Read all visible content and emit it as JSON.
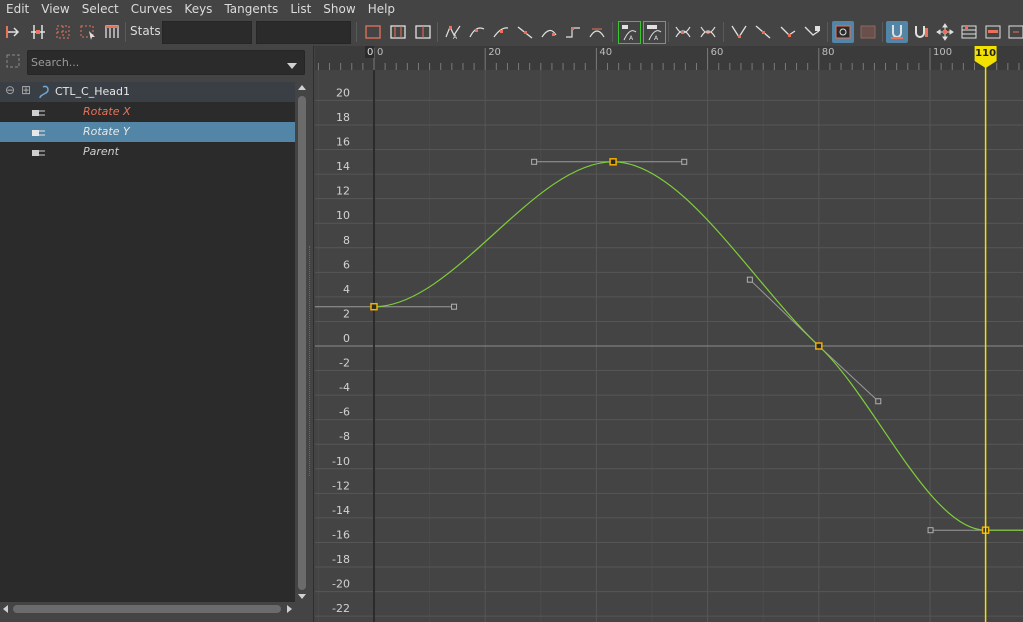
{
  "menubar": {
    "items": [
      "Edit",
      "View",
      "Select",
      "Curves",
      "Keys",
      "Tangents",
      "List",
      "Show",
      "Help"
    ]
  },
  "toolbar": {
    "stats_label": "Stats",
    "icons": [
      "move-nearest-picked-key-icon",
      "insert-keys-icon",
      "lattice-deform-keys-icon",
      "region-keys-icon",
      "retime-tool-icon",
      "normalize-curves-icon",
      "denormalize-curves-icon",
      "simplify-curves-icon",
      "auto-tangent-icon",
      "spline-tangent-icon",
      "clamped-tangent-icon",
      "linear-tangent-icon",
      "flat-tangent-icon",
      "step-tangent-icon",
      "plateau-tangent-icon",
      "default-in-tangent-icon",
      "default-out-tangent-icon",
      "buffer-curve-snapshot-icon",
      "swap-buffer-curve-icon",
      "break-tangents-icon",
      "unify-tangents-icon",
      "free-tangent-weight-icon",
      "lock-tangent-weight-icon",
      "auto-load-icon",
      "load-selected-icon",
      "time-snap-icon",
      "value-snap-icon",
      "frame-all-icon",
      "dope-sheet-icon",
      "trax-editor-icon",
      "scroll-right-icon"
    ],
    "accent": "#5285a6"
  },
  "outliner": {
    "search_placeholder": "Search...",
    "node": {
      "label": "CTL_C_Head1",
      "expand_symbol": "⊖",
      "add_symbol": "⊞"
    },
    "attributes": [
      {
        "label": "Rotate X",
        "color": "#e8735a",
        "selected": false
      },
      {
        "label": "Rotate Y",
        "color": "#e8e8e8",
        "selected": true
      },
      {
        "label": "Parent",
        "color": "#cfcfcf",
        "selected": false
      }
    ],
    "selected_color": "#5285a6"
  },
  "graph": {
    "current_frame": "110",
    "timeline_start_label": "0",
    "time_marker_color": "#f2e000",
    "curve_color": "#7fcf3a",
    "key_color": "#f2b000"
  },
  "chart_data": {
    "type": "line",
    "title": "",
    "xlabel": "",
    "ylabel": "",
    "xlim": [
      -10.6,
      116.7
    ],
    "ylim": [
      -23,
      23
    ],
    "x_ticks": [
      0,
      20,
      40,
      60,
      80,
      100
    ],
    "y_ticks": [
      20,
      18,
      16,
      14,
      12,
      10,
      8,
      6,
      4,
      2,
      0,
      -2,
      -4,
      -6,
      -8,
      -10,
      -12,
      -14,
      -16,
      -18,
      -20,
      -22
    ],
    "grid": true,
    "keys": [
      {
        "frame": 0,
        "value": 3.2,
        "in_tangent": [
          -14.4,
          3.2
        ],
        "out_tangent": [
          14.4,
          3.2
        ]
      },
      {
        "frame": 43,
        "value": 15.0,
        "in_tangent": [
          28.8,
          15.0
        ],
        "out_tangent": [
          55.8,
          15.0
        ]
      },
      {
        "frame": 80,
        "value": 0.0,
        "in_tangent": [
          67.6,
          5.4
        ],
        "out_tangent": [
          90.7,
          -4.5
        ]
      },
      {
        "frame": 110,
        "value": -15.0,
        "in_tangent": [
          100.1,
          -15.0
        ],
        "out_tangent": [
          119.9,
          -15.0
        ]
      }
    ],
    "series": [
      {
        "name": "Rotate Y",
        "x": [
          0,
          5,
          10,
          15,
          20,
          25,
          30,
          35,
          40,
          43,
          48,
          53,
          58,
          63,
          68,
          73,
          78,
          80,
          85,
          90,
          95,
          100,
          105,
          110,
          116
        ],
        "values": [
          3.2,
          3.8,
          5.3,
          7.3,
          9.3,
          11.3,
          12.9,
          14.1,
          14.8,
          15.0,
          14.7,
          13.6,
          11.7,
          9.2,
          6.2,
          3.1,
          0.8,
          0.0,
          -3.5,
          -7.3,
          -10.7,
          -13.3,
          -14.7,
          -15.0,
          -15.0
        ]
      }
    ]
  }
}
